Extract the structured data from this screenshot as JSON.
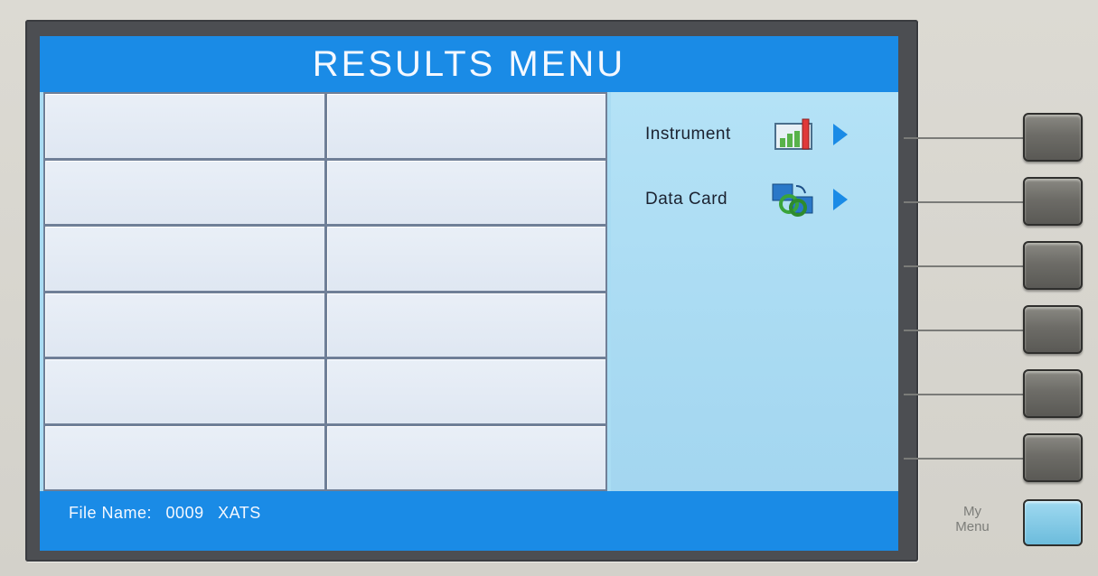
{
  "screen": {
    "title": "RESULTS MENU",
    "status": {
      "file_name_label": "File Name:",
      "file_number": "0009",
      "file_id": "XATS"
    }
  },
  "side_menu": {
    "items": [
      {
        "label": "Instrument",
        "icon": "bar-chart-icon"
      },
      {
        "label": "Data Card",
        "icon": "data-card-sync-icon"
      }
    ]
  },
  "hardware": {
    "my_menu_label_line1": "My",
    "my_menu_label_line2": "Menu",
    "soft_keys": 6
  },
  "colors": {
    "title_bar": "#1a8be6",
    "side_panel": "#a9dcf3",
    "grid_cell": "#e3eaf4",
    "my_menu_button": "#86cbe6"
  }
}
